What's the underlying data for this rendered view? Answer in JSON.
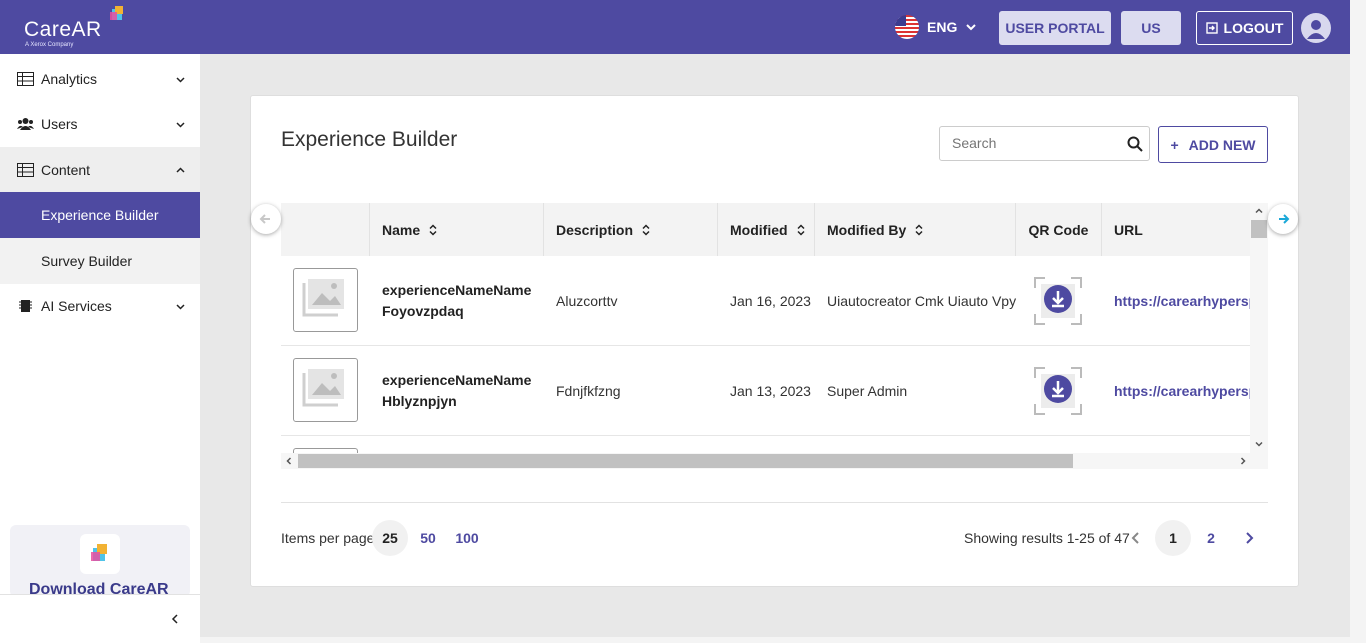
{
  "header": {
    "logo_text": "CareAR",
    "logo_sub": "A Xerox Company",
    "language": "ENG",
    "user_portal_label": "USER PORTAL",
    "us_label": "US",
    "logout_label": "LOGOUT",
    "brand_color": "#4e4aa1"
  },
  "sidebar": {
    "items": [
      {
        "label": "Analytics",
        "icon": "table-icon"
      },
      {
        "label": "Users",
        "icon": "users-icon"
      },
      {
        "label": "Content",
        "icon": "table-icon"
      },
      {
        "label": "Experience Builder"
      },
      {
        "label": "Survey Builder"
      },
      {
        "label": "AI Services",
        "icon": "chip-icon"
      }
    ],
    "download_label": "Download CareAR"
  },
  "page": {
    "title": "Experience Builder",
    "search_placeholder": "Search",
    "add_new_label": "ADD NEW"
  },
  "table": {
    "columns": [
      "Name",
      "Description",
      "Modified",
      "Modified By",
      "QR Code",
      "URL"
    ],
    "rows": [
      {
        "name": "experienceNameNameFoyovzpdaq",
        "description": "Aluzcorttv",
        "modified": "Jan 16, 2023",
        "modified_by": "Uiautocreator Cmk Uiauto Vpy",
        "url": "https://carearhypersp"
      },
      {
        "name": "experienceNameNameHblyznpjyn",
        "description": "Fdnjfkfzng",
        "modified": "Jan 13, 2023",
        "modified_by": "Super Admin",
        "url": "https://carearhypersp"
      }
    ]
  },
  "pagination": {
    "items_per_page_label": "Items per page:",
    "options": [
      "25",
      "50",
      "100"
    ],
    "selected": "25",
    "results_text": "Showing results 1-25 of 47",
    "pages": [
      "1",
      "2"
    ],
    "current_page": "1"
  }
}
